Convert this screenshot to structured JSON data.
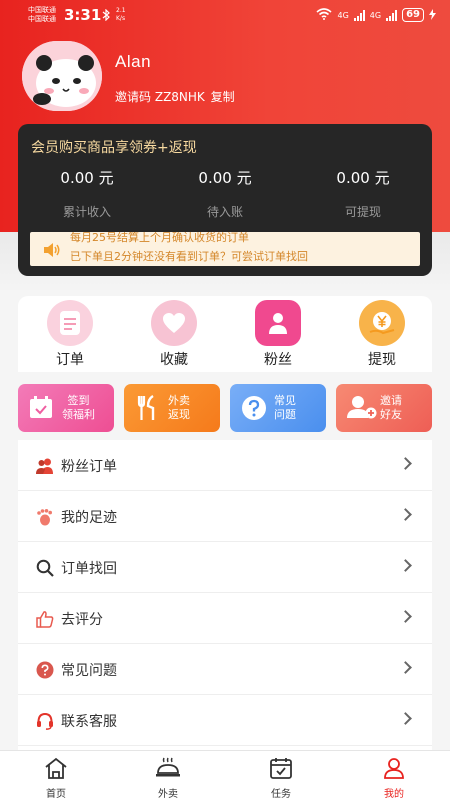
{
  "status_bar": {
    "carrier1": "中国联通",
    "carrier2": "中国联通",
    "time": "3:31",
    "speed": "2.1",
    "speed_unit": "K/s",
    "network1": "4G",
    "network2": "4G",
    "battery": "69"
  },
  "profile": {
    "name": "Alan",
    "invite_label": "邀请码",
    "invite_code": "ZZ8NHK",
    "copy_label": "复制"
  },
  "member_card": {
    "title": "会员购买商品享领券+返现",
    "stats": [
      {
        "value": "0.00 元",
        "label": "累计收入"
      },
      {
        "value": "0.00 元",
        "label": "待入账"
      },
      {
        "value": "0.00 元",
        "label": "可提现"
      }
    ],
    "notice_line1": "每月25号结算上个月确认收货的订单",
    "notice_line2": "已下单且2分钟还没有看到订单？可尝试订单找回"
  },
  "quick_actions": [
    {
      "label": "订单",
      "icon": "order-icon",
      "color": "#f9c8d6"
    },
    {
      "label": "收藏",
      "icon": "heart-icon",
      "color": "#f9c8d6"
    },
    {
      "label": "粉丝",
      "icon": "fans-icon",
      "color": "#f0498f"
    },
    {
      "label": "提现",
      "icon": "withdraw-icon",
      "color": "#f6a43a"
    }
  ],
  "feature_buttons": [
    {
      "line1": "签到",
      "line2": "领福利",
      "icon": "calendar-icon",
      "color": "#f0509a"
    },
    {
      "line1": "外卖",
      "line2": "返现",
      "icon": "cutlery-icon",
      "color": "#f7801f"
    },
    {
      "line1": "常见",
      "line2": "问题",
      "icon": "question-icon",
      "color": "#4f94ee"
    },
    {
      "line1": "邀请",
      "line2": "好友",
      "icon": "add-user-icon",
      "color": "#f0665a"
    }
  ],
  "menu": [
    {
      "label": "粉丝订单",
      "icon": "users-icon"
    },
    {
      "label": "我的足迹",
      "icon": "footprint-icon"
    },
    {
      "label": "订单找回",
      "icon": "search-icon"
    },
    {
      "label": "去评分",
      "icon": "thumbs-up-icon"
    },
    {
      "label": "常见问题",
      "icon": "help-icon"
    },
    {
      "label": "联系客服",
      "icon": "headset-icon"
    }
  ],
  "tabs": [
    {
      "label": "首页",
      "icon": "home-icon"
    },
    {
      "label": "外卖",
      "icon": "food-cover-icon"
    },
    {
      "label": "任务",
      "icon": "task-icon"
    },
    {
      "label": "我的",
      "icon": "profile-icon"
    }
  ],
  "colors": {
    "brand_red": "#e8231f",
    "card_dark": "#262626",
    "gold_text": "#f7d9a0",
    "notice_text": "#d4872a"
  }
}
